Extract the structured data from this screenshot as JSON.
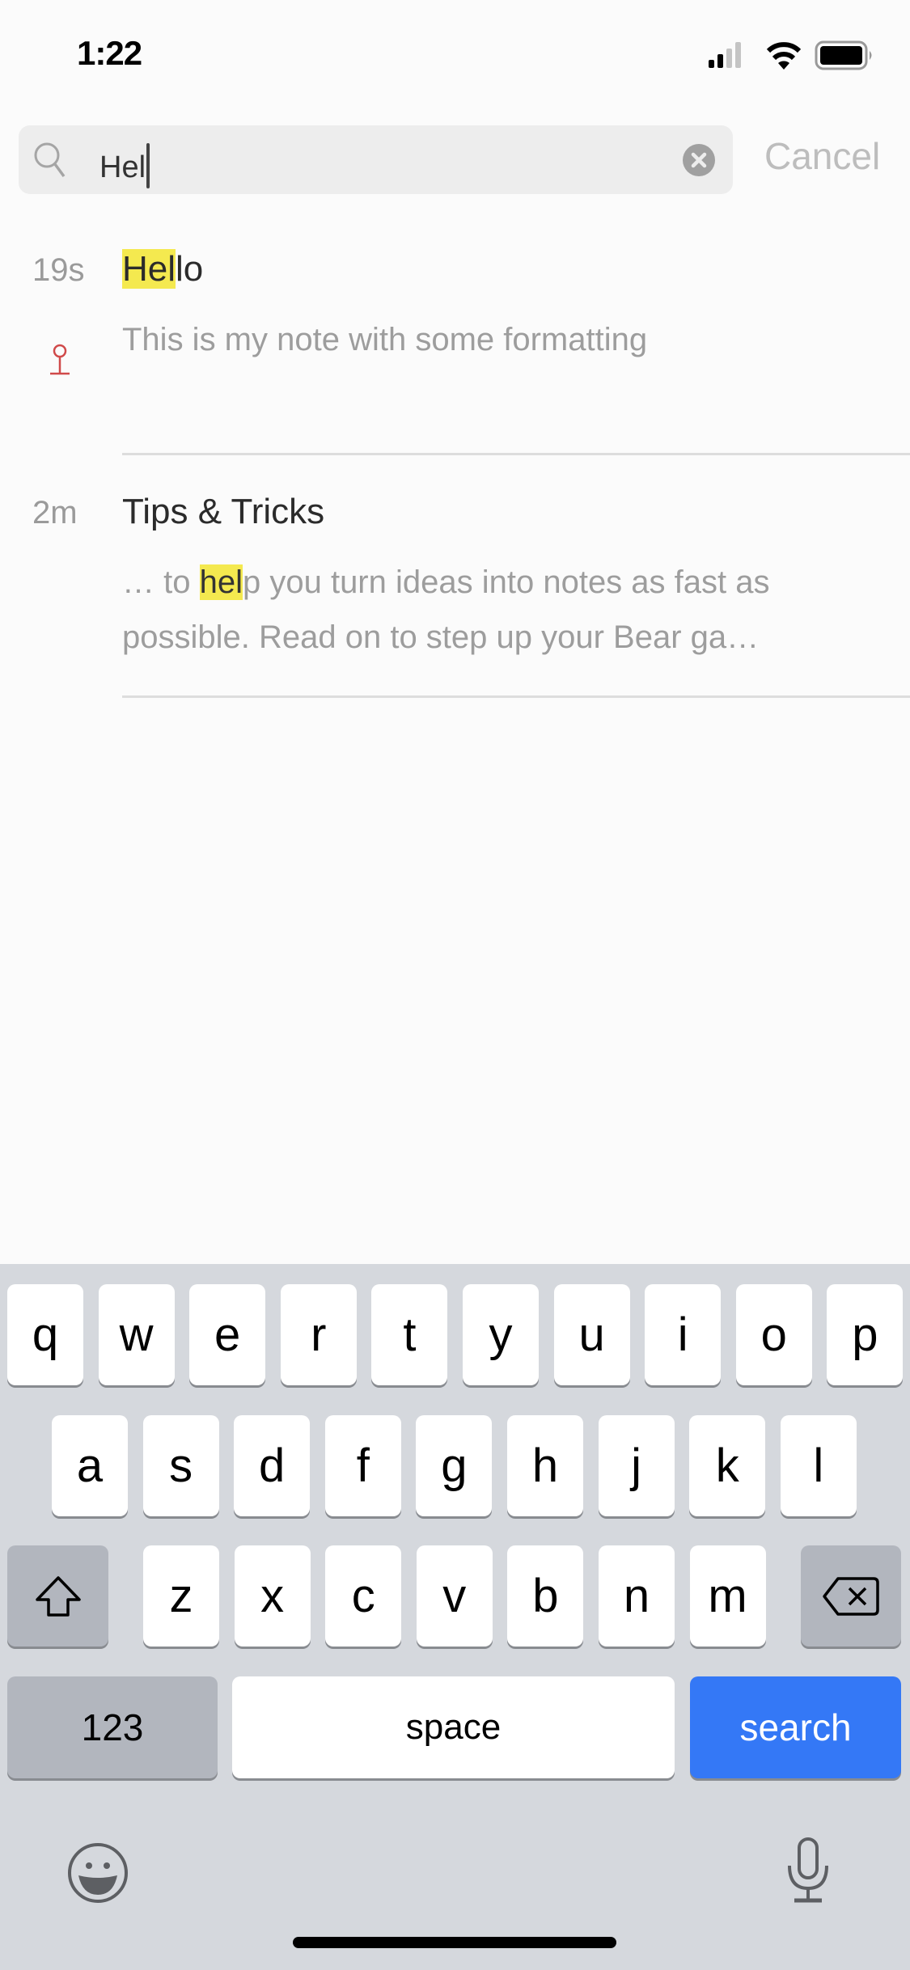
{
  "status_bar": {
    "time": "1:22",
    "signal_icon": "cellular-signal-icon",
    "wifi_icon": "wifi-icon",
    "battery_icon": "battery-icon"
  },
  "search": {
    "value": "Hel",
    "clear_icon": "clear-icon",
    "cancel_label": "Cancel"
  },
  "results": [
    {
      "age": "19s",
      "title_highlight": "Hel",
      "title_rest": "lo",
      "snippet_prefix": "",
      "snippet_highlight": "",
      "snippet_rest": "This is my note with some formatting",
      "pinned": true
    },
    {
      "age": "2m",
      "title_highlight": "",
      "title_rest": "Tips & Tricks",
      "snippet_prefix": "… to ",
      "snippet_highlight": "hel",
      "snippet_rest": "p you turn ideas into notes as fast as possible. Read on to step up your Bear ga…",
      "pinned": false
    }
  ],
  "colors": {
    "highlight": "#f4e94f",
    "pin": "#d0021b",
    "search_key": "#3478f6"
  },
  "keyboard": {
    "row1": [
      "q",
      "w",
      "e",
      "r",
      "t",
      "y",
      "u",
      "i",
      "o",
      "p"
    ],
    "row2": [
      "a",
      "s",
      "d",
      "f",
      "g",
      "h",
      "j",
      "k",
      "l"
    ],
    "row3": [
      "z",
      "x",
      "c",
      "v",
      "b",
      "n",
      "m"
    ],
    "numbers_label": "123",
    "space_label": "space",
    "search_label": "search"
  }
}
